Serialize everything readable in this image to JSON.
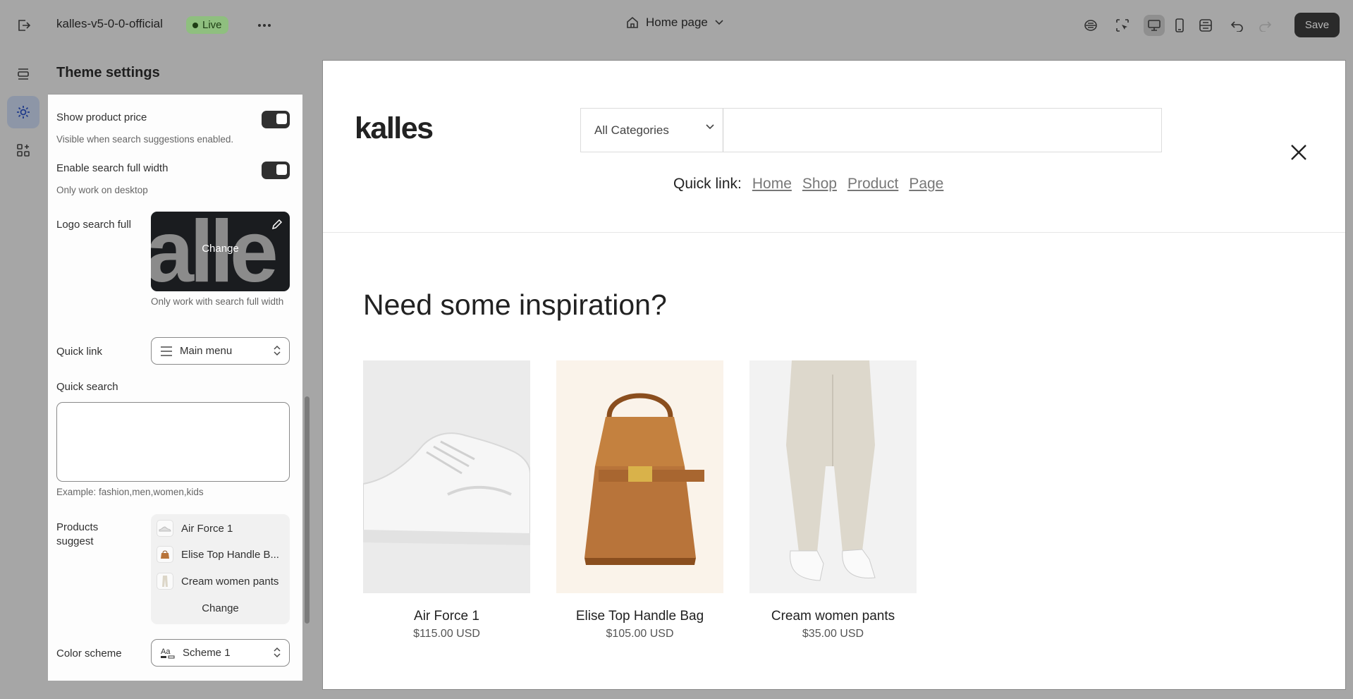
{
  "topbar": {
    "store_name": "kalles-v5-0-0-official",
    "live_label": "Live",
    "page_label": "Home page",
    "save_label": "Save"
  },
  "panel": {
    "title": "Theme settings",
    "show_price_label": "Show product price",
    "show_price_help": "Visible when search suggestions enabled.",
    "full_width_label": "Enable search full width",
    "full_width_help": "Only work on desktop",
    "logo_label": "Logo search full",
    "logo_change": "Change",
    "logo_letters": "alle",
    "logo_help": "Only work with search full width",
    "quick_link_label": "Quick link",
    "quick_link_value": "Main menu",
    "quick_search_label": "Quick search",
    "quick_search_value": "",
    "quick_search_help": "Example: fashion,men,women,kids",
    "products_suggest_label": "Products suggest",
    "products": [
      "Air Force 1",
      "Elise Top Handle B...",
      "Cream women pants"
    ],
    "products_change": "Change",
    "color_scheme_label": "Color scheme",
    "color_scheme_value": "Scheme 1"
  },
  "preview": {
    "brand": "kalles",
    "category": "All Categories",
    "search_value": "",
    "quick_link_title": "Quick link:",
    "quick_links": [
      "Home",
      "Shop",
      "Product",
      "Page"
    ],
    "heading": "Need some inspiration?",
    "cards": [
      {
        "name": "Air Force 1",
        "price": "$115.00 USD"
      },
      {
        "name": "Elise Top Handle Bag",
        "price": "$105.00 USD"
      },
      {
        "name": "Cream women pants",
        "price": "$35.00 USD"
      }
    ]
  },
  "colors": {
    "overlay_gray": "#a6a6a6",
    "live_badge": "#8fbf7f",
    "save_button": "#2a2a2a",
    "bag_brown": "#b8743a"
  },
  "icons": [
    "exit-icon",
    "ellipsis-icon",
    "home-icon",
    "chevron-down-icon",
    "sparkle-app-icon",
    "inspector-icon",
    "desktop-icon",
    "mobile-icon",
    "fullscreen-icon",
    "undo-icon",
    "redo-icon",
    "sections-icon",
    "gear-icon",
    "apps-icon",
    "pencil-icon",
    "menu-lines-icon",
    "typography-icon",
    "close-icon"
  ]
}
